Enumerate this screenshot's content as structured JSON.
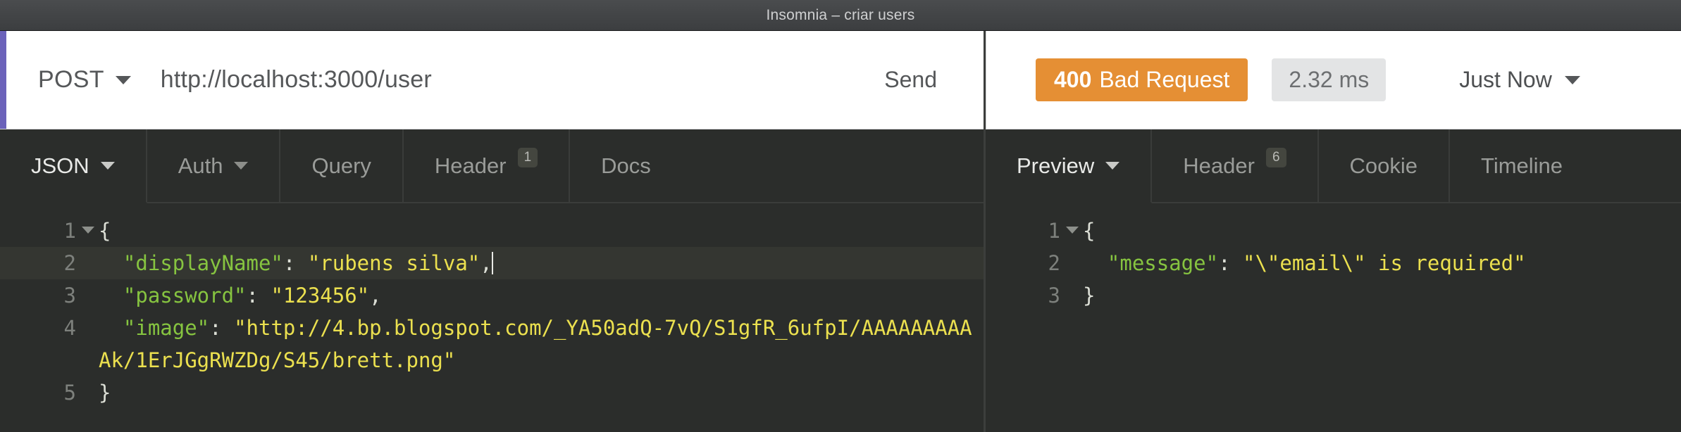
{
  "window": {
    "title": "Insomnia – criar users"
  },
  "request": {
    "method": "POST",
    "method_caret": "chevron-down-icon",
    "url": "http://localhost:3000/user",
    "send_label": "Send",
    "tabs": [
      {
        "label": "JSON",
        "active": true,
        "caret": true,
        "badge": null
      },
      {
        "label": "Auth",
        "active": false,
        "caret": true,
        "badge": null
      },
      {
        "label": "Query",
        "active": false,
        "caret": false,
        "badge": null
      },
      {
        "label": "Header",
        "active": false,
        "caret": false,
        "badge": "1"
      },
      {
        "label": "Docs",
        "active": false,
        "caret": false,
        "badge": null
      }
    ],
    "body_lines": [
      {
        "num": "1",
        "fold": true,
        "highlight": false,
        "segments": [
          {
            "text": "{",
            "type": "punc"
          }
        ]
      },
      {
        "num": "2",
        "fold": false,
        "highlight": true,
        "cursor": true,
        "segments": [
          {
            "text": "  ",
            "type": "punc"
          },
          {
            "text": "\"displayName\"",
            "type": "key"
          },
          {
            "text": ": ",
            "type": "colon"
          },
          {
            "text": "\"rubens silva\"",
            "type": "str"
          },
          {
            "text": ",",
            "type": "punc"
          }
        ]
      },
      {
        "num": "3",
        "fold": false,
        "highlight": false,
        "segments": [
          {
            "text": "  ",
            "type": "punc"
          },
          {
            "text": "\"password\"",
            "type": "key"
          },
          {
            "text": ": ",
            "type": "colon"
          },
          {
            "text": "\"123456\"",
            "type": "str"
          },
          {
            "text": ",",
            "type": "punc"
          }
        ]
      },
      {
        "num": "4",
        "fold": false,
        "highlight": false,
        "segments": [
          {
            "text": "  ",
            "type": "punc"
          },
          {
            "text": "\"image\"",
            "type": "key"
          },
          {
            "text": ": ",
            "type": "colon"
          },
          {
            "text": "\"http://4.bp.blogspot.com/_YA50adQ-7vQ/S1gfR_6ufpI/AAAAAAAAAAk/1ErJGgRWZDg/S45/brett.png\"",
            "type": "str"
          }
        ]
      },
      {
        "num": "5",
        "fold": false,
        "highlight": false,
        "segments": [
          {
            "text": "}",
            "type": "punc"
          }
        ]
      }
    ]
  },
  "response": {
    "status_code": "400",
    "status_message": "Bad Request",
    "status_color": "#e58f34",
    "time": "2.32 ms",
    "history_label": "Just Now",
    "tabs": [
      {
        "label": "Preview",
        "active": true,
        "caret": true,
        "badge": null
      },
      {
        "label": "Header",
        "active": false,
        "caret": false,
        "badge": "6"
      },
      {
        "label": "Cookie",
        "active": false,
        "caret": false,
        "badge": null
      },
      {
        "label": "Timeline",
        "active": false,
        "caret": false,
        "badge": null
      }
    ],
    "body_lines": [
      {
        "num": "1",
        "fold": true,
        "highlight": false,
        "segments": [
          {
            "text": "{",
            "type": "punc"
          }
        ]
      },
      {
        "num": "2",
        "fold": false,
        "highlight": false,
        "segments": [
          {
            "text": "  ",
            "type": "punc"
          },
          {
            "text": "\"message\"",
            "type": "key"
          },
          {
            "text": ": ",
            "type": "colon"
          },
          {
            "text": "\"\\\"email\\\" is required\"",
            "type": "str"
          }
        ]
      },
      {
        "num": "3",
        "fold": false,
        "highlight": false,
        "segments": [
          {
            "text": "}",
            "type": "punc"
          }
        ]
      }
    ]
  }
}
